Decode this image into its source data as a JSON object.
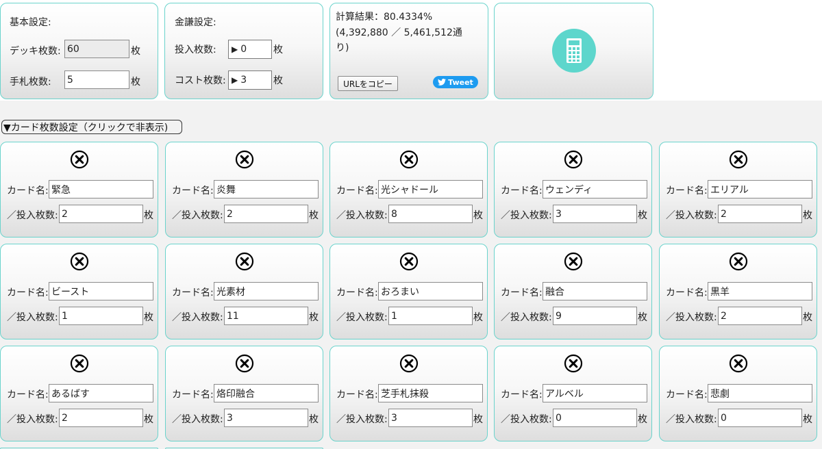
{
  "basic": {
    "title": "基本設定:",
    "deck_label": "デッキ枚数:",
    "deck_value": "60",
    "hand_label": "手札枚数:",
    "hand_value": "5",
    "unit": "枚"
  },
  "tax": {
    "title": "金謙設定:",
    "insert_label": "投入枚数:",
    "insert_value": "0",
    "cost_label": "コスト枚数:",
    "cost_value": "3",
    "unit": "枚"
  },
  "result": {
    "line1": "計算結果：80.4334%",
    "line2": "(4,392,880 ／ 5,461,512通",
    "line3": "り)",
    "copy_label": "URLをコピー",
    "tweet_label": "Tweet"
  },
  "toggle_label": "▼カード枚数設定（クリックで非表示)",
  "card_labels": {
    "name": "カード名:",
    "count": "／投入枚数:",
    "unit": "枚"
  },
  "cards": [
    {
      "name": "緊急",
      "count": "2"
    },
    {
      "name": "炎舞",
      "count": "2"
    },
    {
      "name": "光シャドール",
      "count": "8"
    },
    {
      "name": "ウェンディ",
      "count": "3"
    },
    {
      "name": "エリアル",
      "count": "2"
    },
    {
      "name": "ビースト",
      "count": "1"
    },
    {
      "name": "光素材",
      "count": "11"
    },
    {
      "name": "おろまい",
      "count": "1"
    },
    {
      "name": "融合",
      "count": "9"
    },
    {
      "name": "黒羊",
      "count": "2"
    },
    {
      "name": "あるばす",
      "count": "2"
    },
    {
      "name": "烙印融合",
      "count": "3"
    },
    {
      "name": "芝手札抹殺",
      "count": "3"
    },
    {
      "name": "アルベル",
      "count": "0"
    },
    {
      "name": "悲劇",
      "count": "0"
    }
  ],
  "colors": {
    "accent": "#6ad3cc",
    "calc_circle": "#5dd6cc",
    "tweet": "#1d9bf0"
  },
  "icons": {
    "remove": "close-circle-icon",
    "calculator": "calculator-icon",
    "twitter": "twitter-bird-icon",
    "stepper": "play-triangle-icon"
  }
}
